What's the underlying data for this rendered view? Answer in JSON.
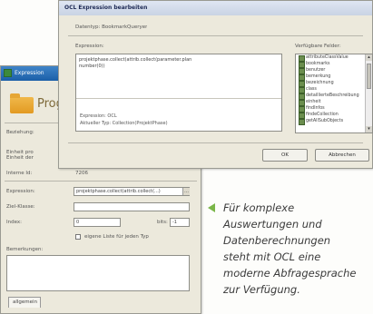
{
  "back_window": {
    "title": "Expression",
    "header_title": "Prog",
    "fields": {
      "beziehung_label": "Beziehung:",
      "einheit_label": "Einheit pro Einheit der",
      "internal_id_label": "Interne Id:",
      "internal_id_value": "7206",
      "expression_label": "Expression:",
      "expression_value": "projektphase.collect(attrib.collect(...)",
      "ziel_klasse_label": "Ziel-Klasse:",
      "index_label": "Index:",
      "index_value": "0",
      "bits_label": "bits:",
      "bits_value": "-1",
      "checkbox_label": "eigene Liste für jeden Typ",
      "bemerkungen_label": "Bemerkungen:"
    },
    "tab_label": "allgemein"
  },
  "dialog": {
    "title": "OCL Expression bearbeiten",
    "context": "Datentyp: BookmarkQueryer",
    "expression_label": "Expression:",
    "expression_text": "projektphase.collect(attrib.collect(parameter.plan\nnumber(0))",
    "info_line1": "Expression: OCL",
    "info_line2": "Aktueller Typ: Collection(ProjektPhase)",
    "features_label": "Verfügbare Felder:",
    "features": [
      "attributeClassValue",
      "bookmarks",
      "benutzer",
      "bemerkung",
      "bezeichnung",
      "class",
      "detaillierteBeschreibung",
      "einheit",
      "findInfos",
      "findeCollection",
      "getAllSubObjects"
    ],
    "ok_label": "OK",
    "cancel_label": "Abbrechen"
  },
  "caption": {
    "lines": [
      "Für komplexe",
      "Auswertungen und",
      "Datenberechnungen",
      "steht mit OCL eine",
      "moderne Abfragesprache",
      "zur Verfügung."
    ]
  },
  "colors": {
    "accent_arrow": "#7ab648"
  }
}
